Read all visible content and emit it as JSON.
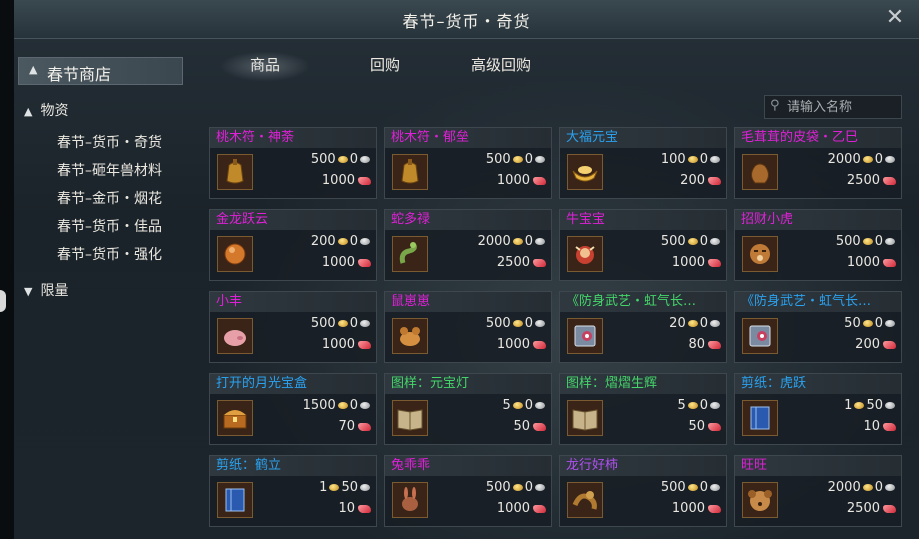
{
  "window": {
    "title": "春节–货币・奇货"
  },
  "sidebar": {
    "shop_label": "春节商店",
    "groups": [
      {
        "label": "物资",
        "expanded": true,
        "items": [
          "春节–货币・奇货",
          "春节–砸年兽材料",
          "春节–金币・烟花",
          "春节–货币・佳品",
          "春节–货币・强化"
        ]
      },
      {
        "label": "限量",
        "expanded": false
      }
    ]
  },
  "tabs": [
    "商品",
    "回购",
    "高级回购"
  ],
  "active_tab": "商品",
  "search": {
    "placeholder": "请输入名称",
    "value": ""
  },
  "colors": {
    "name_magenta": "#e020d8",
    "name_blue": "#2aa2f0",
    "name_green": "#44d66a",
    "name_purple": "#b050f0"
  },
  "items": [
    {
      "name": "桃木符・神荼",
      "name_color": "#e020d8",
      "icon": "bell-pouch-icon",
      "price_gold": "500",
      "price_silver": "0",
      "price_token": "1000"
    },
    {
      "name": "桃木符・郁垒",
      "name_color": "#e020d8",
      "icon": "bell-pouch-icon",
      "price_gold": "500",
      "price_silver": "0",
      "price_token": "1000"
    },
    {
      "name": "大福元宝",
      "name_color": "#2aa2f0",
      "icon": "gold-ingot-icon",
      "price_gold": "100",
      "price_silver": "0",
      "price_token": "200"
    },
    {
      "name": "毛茸茸的皮袋・乙巳",
      "name_color": "#e020d8",
      "icon": "pouch-icon",
      "price_gold": "2000",
      "price_silver": "0",
      "price_token": "2500"
    },
    {
      "name": "金龙跃云",
      "name_color": "#e020d8",
      "icon": "orb-icon",
      "price_gold": "200",
      "price_silver": "0",
      "price_token": "1000"
    },
    {
      "name": "蛇多禄",
      "name_color": "#e020d8",
      "icon": "snake-icon",
      "price_gold": "2000",
      "price_silver": "0",
      "price_token": "2500"
    },
    {
      "name": "牛宝宝",
      "name_color": "#e020d8",
      "icon": "ox-doll-icon",
      "price_gold": "500",
      "price_silver": "0",
      "price_token": "1000"
    },
    {
      "name": "招财小虎",
      "name_color": "#e020d8",
      "icon": "tiger-doll-icon",
      "price_gold": "500",
      "price_silver": "0",
      "price_token": "1000"
    },
    {
      "name": "小丰",
      "name_color": "#e020d8",
      "icon": "pig-icon",
      "price_gold": "500",
      "price_silver": "0",
      "price_token": "1000"
    },
    {
      "name": "鼠崽崽",
      "name_color": "#e020d8",
      "icon": "mouse-icon",
      "price_gold": "500",
      "price_silver": "0",
      "price_token": "1000"
    },
    {
      "name": "《防身武艺・虹气长…",
      "name_color": "#44d66a",
      "icon": "skill-book-icon",
      "price_gold": "20",
      "price_silver": "0",
      "price_token": "80"
    },
    {
      "name": "《防身武艺・虹气长…",
      "name_color": "#2aa2f0",
      "icon": "skill-book-icon",
      "price_gold": "50",
      "price_silver": "0",
      "price_token": "200"
    },
    {
      "name": "打开的月光宝盒",
      "name_color": "#2aa2f0",
      "icon": "treasure-chest-icon",
      "price_gold": "1500",
      "price_silver": "0",
      "price_token": "70"
    },
    {
      "name": "图样：元宝灯",
      "name_color": "#44d66a",
      "icon": "pattern-book-icon",
      "price_gold": "5",
      "price_silver": "0",
      "price_token": "50"
    },
    {
      "name": "图样：熠熠生辉",
      "name_color": "#44d66a",
      "icon": "pattern-book-icon",
      "price_gold": "5",
      "price_silver": "0",
      "price_token": "50"
    },
    {
      "name": "剪纸：虎跃",
      "name_color": "#2aa2f0",
      "icon": "papercut-book-icon",
      "price_gold": "1",
      "price_silver": "50",
      "price_token": "10"
    },
    {
      "name": "剪纸：鹤立",
      "name_color": "#2aa2f0",
      "icon": "papercut-book-icon",
      "price_gold": "1",
      "price_silver": "50",
      "price_token": "10"
    },
    {
      "name": "兔乖乖",
      "name_color": "#e020d8",
      "icon": "rabbit-icon",
      "price_gold": "500",
      "price_silver": "0",
      "price_token": "1000"
    },
    {
      "name": "龙行好柿",
      "name_color": "#b050f0",
      "icon": "dragon-icon",
      "price_gold": "500",
      "price_silver": "0",
      "price_token": "1000"
    },
    {
      "name": "旺旺",
      "name_color": "#e020d8",
      "icon": "dog-plush-icon",
      "price_gold": "2000",
      "price_silver": "0",
      "price_token": "2500"
    }
  ]
}
